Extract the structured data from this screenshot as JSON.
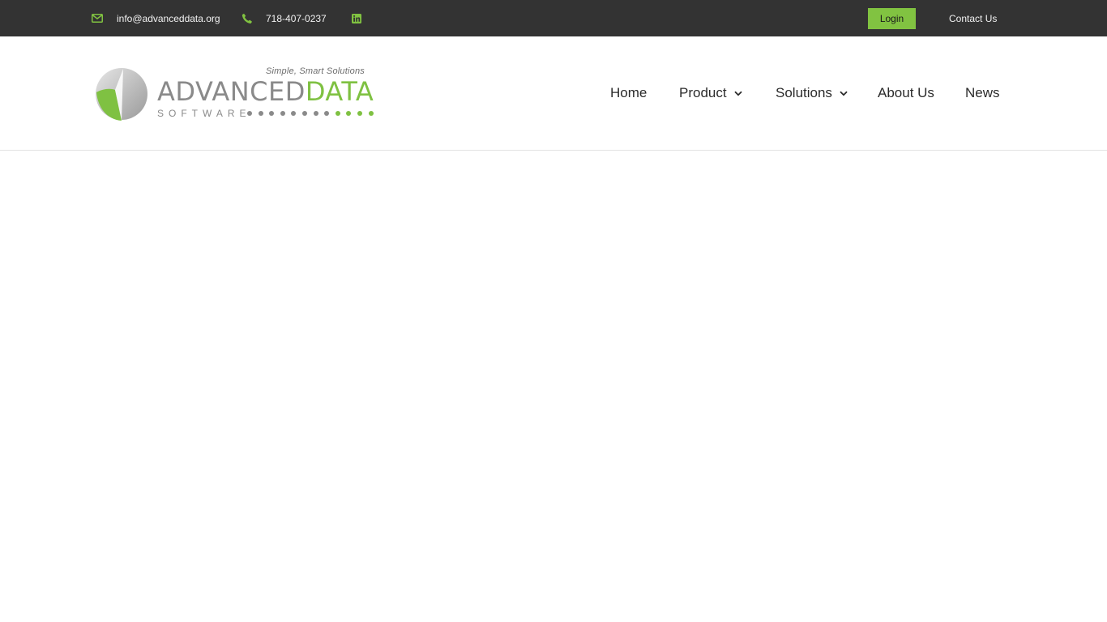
{
  "topbar": {
    "email": "info@advanceddata.org",
    "phone": "718-407-0237",
    "login_label": "Login",
    "contact_label": "Contact Us",
    "icons": {
      "email": "envelope-icon",
      "phone": "phone-icon",
      "social": "linkedin-icon"
    }
  },
  "logo": {
    "tagline": "Simple, Smart Solutions",
    "word_part1": "ADVANCED",
    "word_part2": "DATA",
    "subword": "SOFTWARE"
  },
  "nav": {
    "items": [
      {
        "label": "Home",
        "has_dropdown": false
      },
      {
        "label": "Product",
        "has_dropdown": true
      },
      {
        "label": "Solutions",
        "has_dropdown": true
      },
      {
        "label": "About Us",
        "has_dropdown": false
      },
      {
        "label": "News",
        "has_dropdown": false
      }
    ]
  },
  "colors": {
    "accent": "#81c341",
    "topbar_bg": "#333333",
    "text": "#2b2b2b"
  }
}
